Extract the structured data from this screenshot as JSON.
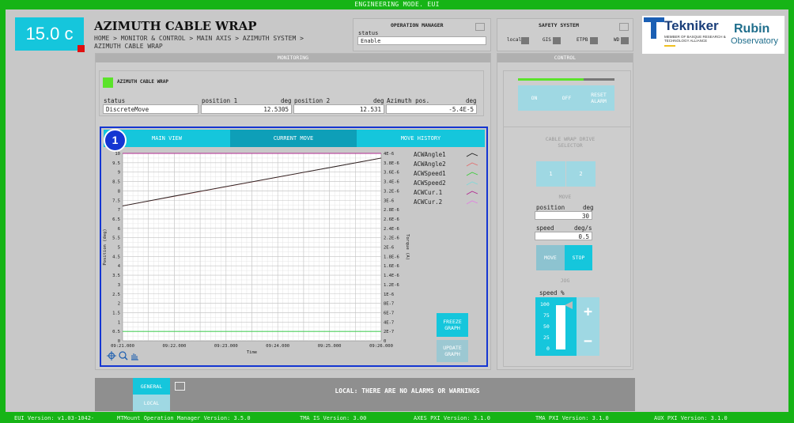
{
  "top_bar": {
    "title": "ENGINEERING MODE. EUI"
  },
  "header": {
    "temperature": "15.0 c",
    "title": "AZIMUTH CABLE WRAP",
    "breadcrumb": "HOME > MONITOR & CONTROL > MAIN AXIS > AZIMUTH SYSTEM > AZIMUTH CABLE WRAP"
  },
  "operation_manager": {
    "title": "OPERATION MANAGER",
    "status_label": "status",
    "status_value": "Enable"
  },
  "safety_system": {
    "title": "SAFETY SYSTEM",
    "indicators": [
      "local",
      "GIS",
      "ETPB",
      "WD"
    ]
  },
  "logos": {
    "tekniker": "Tekniker",
    "tekniker_sub": "MEMBER OF BASQUE RESEARCH & TECHNOLOGY ALLIANCE",
    "rubin_1": "Rubin",
    "rubin_2": "Observatory"
  },
  "monitoring": {
    "header": "MONITORING",
    "device_label": "AZIMUTH CABLE WRAP",
    "fields": [
      {
        "label": "status",
        "unit": "",
        "value": "DiscreteMove"
      },
      {
        "label": "position 1",
        "unit": "deg",
        "value": "12.5305"
      },
      {
        "label": "position 2",
        "unit": "deg",
        "value": "12.531"
      },
      {
        "label": "Azimuth pos.",
        "unit": "deg",
        "value": "-5.4E-5"
      }
    ],
    "tabs": [
      "MAIN VIEW",
      "CURRENT MOVE",
      "MOVE HISTORY"
    ],
    "marker": "1",
    "freeze_button": "FREEZE GRAPH",
    "update_button": "UPDATE GRAPH"
  },
  "chart_data": {
    "type": "line",
    "xlabel": "Time",
    "ylabel": "Position (deg)",
    "y2label": "Torque (A)",
    "x_ticks": [
      "09:21.000",
      "09:22.000",
      "09:23.000",
      "09:24.000",
      "09:25.000",
      "09:26.000"
    ],
    "y_ticks": [
      "0",
      "0.5",
      "1",
      "1.5",
      "2",
      "2.5",
      "3",
      "3.5",
      "4",
      "4.5",
      "5",
      "5.5",
      "6",
      "6.5",
      "7",
      "7.5",
      "8",
      "8.5",
      "9",
      "9.5",
      "10"
    ],
    "y2_ticks": [
      "0",
      "2E-7",
      "4E-7",
      "6E-7",
      "8E-7",
      "1E-6",
      "1.2E-6",
      "1.4E-6",
      "1.6E-6",
      "1.8E-6",
      "2E-6",
      "2.2E-6",
      "2.4E-6",
      "2.6E-6",
      "2.8E-6",
      "3E-6",
      "3.2E-6",
      "3.4E-6",
      "3.6E-6",
      "3.8E-6",
      "4E-6"
    ],
    "ylim": [
      0,
      10
    ],
    "y2lim": [
      0,
      4e-06
    ],
    "xlim": [
      0,
      5
    ],
    "grid": true,
    "legend_position": "right",
    "series": [
      {
        "name": "ACWAngle1",
        "color": "#222222",
        "x": [
          0,
          1,
          2,
          3,
          4,
          5
        ],
        "y": [
          7.2,
          7.72,
          8.23,
          8.74,
          9.24,
          9.75
        ]
      },
      {
        "name": "ACWAngle2",
        "color": "#e07070",
        "x": [
          0,
          5
        ],
        "y": [
          7.2,
          9.75
        ]
      },
      {
        "name": "ACWSpeed1",
        "color": "#3dcc3d",
        "x": [
          0,
          5
        ],
        "y": [
          0.5,
          0.5
        ]
      },
      {
        "name": "ACWSpeed2",
        "color": "#7fd8d8",
        "x": [
          0,
          5
        ],
        "y": [
          0.5,
          0.5
        ]
      },
      {
        "name": "ACWCur.1",
        "color": "#b02890",
        "x": [
          0,
          5
        ],
        "y": [
          10,
          10
        ]
      },
      {
        "name": "ACWCur.2",
        "color": "#e080e0",
        "x": [
          0,
          5
        ],
        "y": [
          10,
          10
        ]
      }
    ]
  },
  "control": {
    "header": "CONTROL",
    "power_on_fraction": 0.68,
    "buttons": [
      "ON",
      "OFF",
      "RESET ALARM"
    ],
    "drive_selector_title": "CABLE WRAP DRIVE SELECTOR",
    "drive_buttons": [
      "1",
      "2"
    ],
    "move_title": "MOVE",
    "position_label": "position",
    "position_unit": "deg",
    "position_value": "30",
    "speed_label": "speed",
    "speed_unit": "deg/s",
    "speed_value": "0.5",
    "move_button": "MOVE",
    "stop_button": "STOP",
    "jog_title": "JOG",
    "jog_speed_label": "speed %",
    "jog_ticks": [
      "100",
      "75",
      "50",
      "25",
      "0"
    ],
    "jog_level_percent": 100,
    "plus": "+",
    "minus": "−"
  },
  "footer": {
    "tabs": [
      "GENERAL",
      "LOCAL"
    ],
    "alarm_text": "LOCAL: THERE ARE NO ALARMS OR WARNINGS"
  },
  "status_bar": [
    "EUI Version: v1.03-1042-",
    "MTMount Operation Manager Version: 3.5.0",
    "TMA IS Version: 3.00",
    "AXES PXI Version: 3.1.0",
    "TMA PXI Version: 3.1.0",
    "AUX PXI Version: 3.1.0"
  ]
}
